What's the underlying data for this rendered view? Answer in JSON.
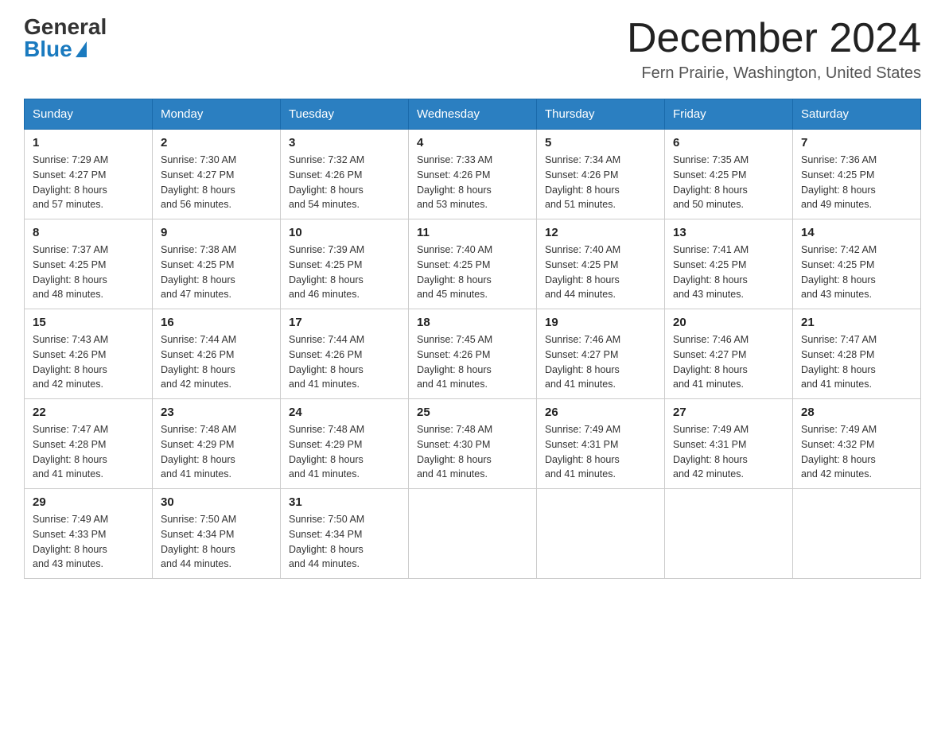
{
  "logo": {
    "general": "General",
    "blue": "Blue"
  },
  "title": {
    "month": "December 2024",
    "location": "Fern Prairie, Washington, United States"
  },
  "weekdays": [
    "Sunday",
    "Monday",
    "Tuesday",
    "Wednesday",
    "Thursday",
    "Friday",
    "Saturday"
  ],
  "weeks": [
    [
      {
        "day": "1",
        "sunrise": "7:29 AM",
        "sunset": "4:27 PM",
        "daylight": "8 hours and 57 minutes."
      },
      {
        "day": "2",
        "sunrise": "7:30 AM",
        "sunset": "4:27 PM",
        "daylight": "8 hours and 56 minutes."
      },
      {
        "day": "3",
        "sunrise": "7:32 AM",
        "sunset": "4:26 PM",
        "daylight": "8 hours and 54 minutes."
      },
      {
        "day": "4",
        "sunrise": "7:33 AM",
        "sunset": "4:26 PM",
        "daylight": "8 hours and 53 minutes."
      },
      {
        "day": "5",
        "sunrise": "7:34 AM",
        "sunset": "4:26 PM",
        "daylight": "8 hours and 51 minutes."
      },
      {
        "day": "6",
        "sunrise": "7:35 AM",
        "sunset": "4:25 PM",
        "daylight": "8 hours and 50 minutes."
      },
      {
        "day": "7",
        "sunrise": "7:36 AM",
        "sunset": "4:25 PM",
        "daylight": "8 hours and 49 minutes."
      }
    ],
    [
      {
        "day": "8",
        "sunrise": "7:37 AM",
        "sunset": "4:25 PM",
        "daylight": "8 hours and 48 minutes."
      },
      {
        "day": "9",
        "sunrise": "7:38 AM",
        "sunset": "4:25 PM",
        "daylight": "8 hours and 47 minutes."
      },
      {
        "day": "10",
        "sunrise": "7:39 AM",
        "sunset": "4:25 PM",
        "daylight": "8 hours and 46 minutes."
      },
      {
        "day": "11",
        "sunrise": "7:40 AM",
        "sunset": "4:25 PM",
        "daylight": "8 hours and 45 minutes."
      },
      {
        "day": "12",
        "sunrise": "7:40 AM",
        "sunset": "4:25 PM",
        "daylight": "8 hours and 44 minutes."
      },
      {
        "day": "13",
        "sunrise": "7:41 AM",
        "sunset": "4:25 PM",
        "daylight": "8 hours and 43 minutes."
      },
      {
        "day": "14",
        "sunrise": "7:42 AM",
        "sunset": "4:25 PM",
        "daylight": "8 hours and 43 minutes."
      }
    ],
    [
      {
        "day": "15",
        "sunrise": "7:43 AM",
        "sunset": "4:26 PM",
        "daylight": "8 hours and 42 minutes."
      },
      {
        "day": "16",
        "sunrise": "7:44 AM",
        "sunset": "4:26 PM",
        "daylight": "8 hours and 42 minutes."
      },
      {
        "day": "17",
        "sunrise": "7:44 AM",
        "sunset": "4:26 PM",
        "daylight": "8 hours and 41 minutes."
      },
      {
        "day": "18",
        "sunrise": "7:45 AM",
        "sunset": "4:26 PM",
        "daylight": "8 hours and 41 minutes."
      },
      {
        "day": "19",
        "sunrise": "7:46 AM",
        "sunset": "4:27 PM",
        "daylight": "8 hours and 41 minutes."
      },
      {
        "day": "20",
        "sunrise": "7:46 AM",
        "sunset": "4:27 PM",
        "daylight": "8 hours and 41 minutes."
      },
      {
        "day": "21",
        "sunrise": "7:47 AM",
        "sunset": "4:28 PM",
        "daylight": "8 hours and 41 minutes."
      }
    ],
    [
      {
        "day": "22",
        "sunrise": "7:47 AM",
        "sunset": "4:28 PM",
        "daylight": "8 hours and 41 minutes."
      },
      {
        "day": "23",
        "sunrise": "7:48 AM",
        "sunset": "4:29 PM",
        "daylight": "8 hours and 41 minutes."
      },
      {
        "day": "24",
        "sunrise": "7:48 AM",
        "sunset": "4:29 PM",
        "daylight": "8 hours and 41 minutes."
      },
      {
        "day": "25",
        "sunrise": "7:48 AM",
        "sunset": "4:30 PM",
        "daylight": "8 hours and 41 minutes."
      },
      {
        "day": "26",
        "sunrise": "7:49 AM",
        "sunset": "4:31 PM",
        "daylight": "8 hours and 41 minutes."
      },
      {
        "day": "27",
        "sunrise": "7:49 AM",
        "sunset": "4:31 PM",
        "daylight": "8 hours and 42 minutes."
      },
      {
        "day": "28",
        "sunrise": "7:49 AM",
        "sunset": "4:32 PM",
        "daylight": "8 hours and 42 minutes."
      }
    ],
    [
      {
        "day": "29",
        "sunrise": "7:49 AM",
        "sunset": "4:33 PM",
        "daylight": "8 hours and 43 minutes."
      },
      {
        "day": "30",
        "sunrise": "7:50 AM",
        "sunset": "4:34 PM",
        "daylight": "8 hours and 44 minutes."
      },
      {
        "day": "31",
        "sunrise": "7:50 AM",
        "sunset": "4:34 PM",
        "daylight": "8 hours and 44 minutes."
      },
      null,
      null,
      null,
      null
    ]
  ],
  "labels": {
    "sunrise": "Sunrise:",
    "sunset": "Sunset:",
    "daylight": "Daylight:"
  }
}
